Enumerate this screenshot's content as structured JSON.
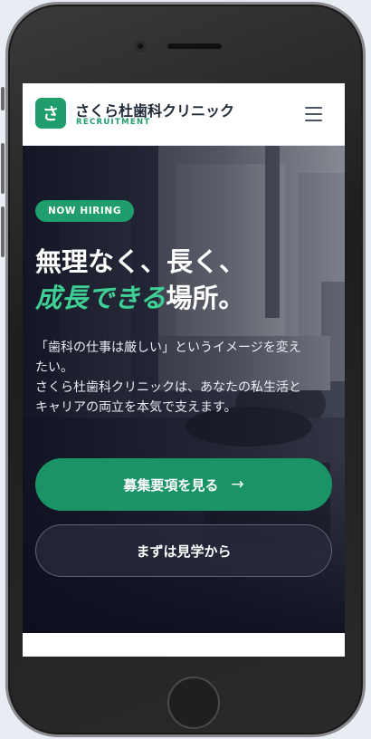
{
  "header": {
    "logo_char": "さ",
    "brand_name": "さくら杜歯科クリニック",
    "brand_sub": "RECRUITMENT"
  },
  "hero": {
    "badge": "NOW HIRING",
    "headline_line1": "無理なく、長く、",
    "headline_accent": "成長できる",
    "headline_tail": "場所。",
    "lead_lines": [
      "「歯科の仕事は厳しい」というイメージを変え",
      "たい。",
      "さくら杜歯科クリニックは、あなたの私生活と",
      "キャリアの両立を本気で支えます。"
    ],
    "cta_primary": "募集要項を見る",
    "cta_primary_icon": "arrow-right-icon",
    "cta_secondary": "まずは見学から"
  },
  "colors": {
    "brand_green": "#1f9d6c",
    "accent_green": "#3fcf94",
    "hero_dark": "#0c0e1e"
  }
}
